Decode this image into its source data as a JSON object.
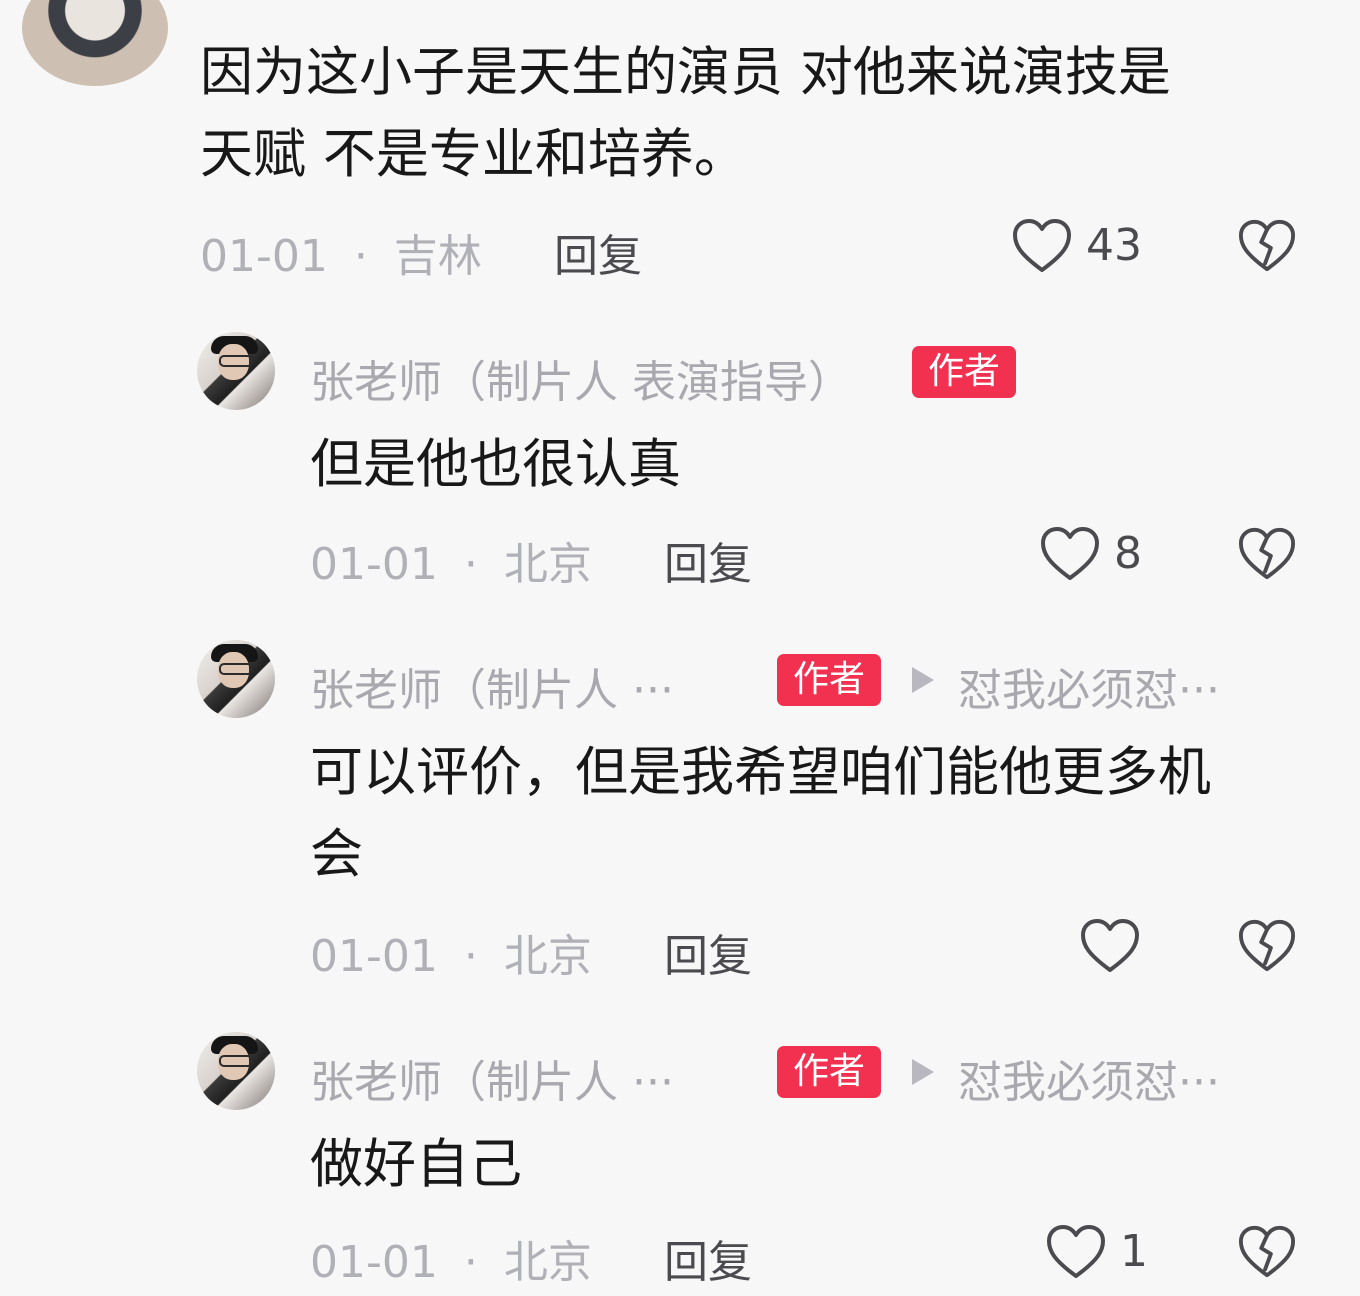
{
  "top_comment": {
    "text": "因为这小子是天生的演员 对他来说演技是天赋 不是专业和培养。",
    "text_line1": "因为这小子是天生的演员 对他来说演技是",
    "text_line2": "天赋 不是专业和培养。",
    "date": "01-01",
    "separator": "·",
    "location": "吉林",
    "reply_label": "回复",
    "like_count": "43"
  },
  "replies": [
    {
      "name": "张老师（制片人 表演指导）",
      "badge": "作者",
      "text": "但是他也很认真",
      "date": "01-01",
      "separator": "·",
      "location": "北京",
      "reply_label": "回复",
      "like_count": "8"
    },
    {
      "name": "张老师（制片人 ···",
      "badge": "作者",
      "reply_to": "怼我必须怼···",
      "text": "可以评价，但是我希望咱们能他更多机会",
      "text_line1": "可以评价，但是我希望咱们能他更多机",
      "text_line2": "会",
      "date": "01-01",
      "separator": "·",
      "location": "北京",
      "reply_label": "回复",
      "like_count": ""
    },
    {
      "name": "张老师（制片人 ···",
      "badge": "作者",
      "reply_to": "怼我必须怼···",
      "text": "做好自己",
      "date": "01-01",
      "separator": "·",
      "location": "北京",
      "reply_label": "回复",
      "like_count": "1"
    }
  ],
  "icons": {
    "like": "heart-outline-icon",
    "dislike": "broken-heart-icon",
    "reply_arrow": "play-triangle-icon"
  },
  "colors": {
    "background": "#f7f7f8",
    "badge": "#f1314f",
    "meta": "#b0b0b7",
    "text": "#181818"
  }
}
